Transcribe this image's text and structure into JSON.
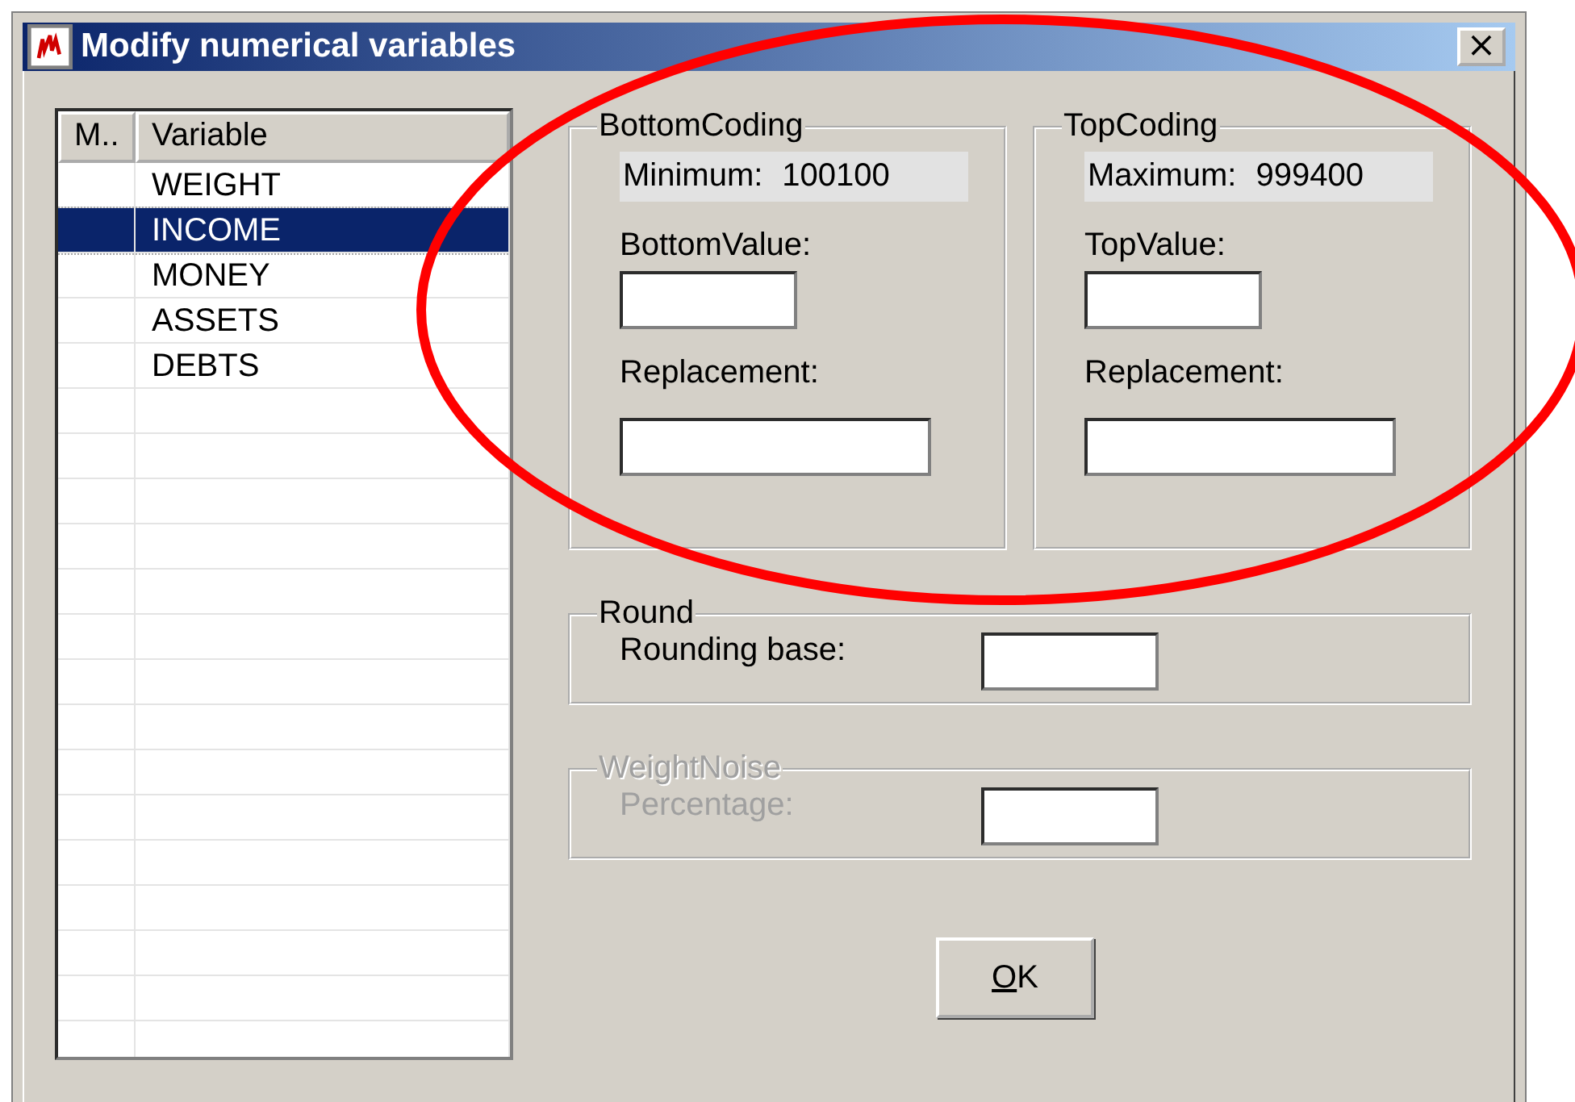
{
  "window": {
    "title": "Modify numerical variables",
    "close": "×"
  },
  "variable_list": {
    "columns": [
      "M..",
      "Variable"
    ],
    "rows": [
      {
        "variable": "WEIGHT",
        "selected": false
      },
      {
        "variable": "INCOME",
        "selected": true
      },
      {
        "variable": "MONEY",
        "selected": false
      },
      {
        "variable": "ASSETS",
        "selected": false
      },
      {
        "variable": "DEBTS",
        "selected": false
      }
    ]
  },
  "bottom_coding": {
    "title": "BottomCoding",
    "info_label": "Minimum:",
    "info_value": "100100",
    "value_label": "BottomValue:",
    "replacement_label": "Replacement:"
  },
  "top_coding": {
    "title": "TopCoding",
    "info_label": "Maximum:",
    "info_value": "999400",
    "value_label": "TopValue:",
    "replacement_label": "Replacement:"
  },
  "round": {
    "title": "Round",
    "label": "Rounding base:",
    "disabled": false
  },
  "weight_noise": {
    "title": "WeightNoise",
    "label": "Percentage:",
    "disabled": true
  },
  "buttons": [
    "OK"
  ]
}
